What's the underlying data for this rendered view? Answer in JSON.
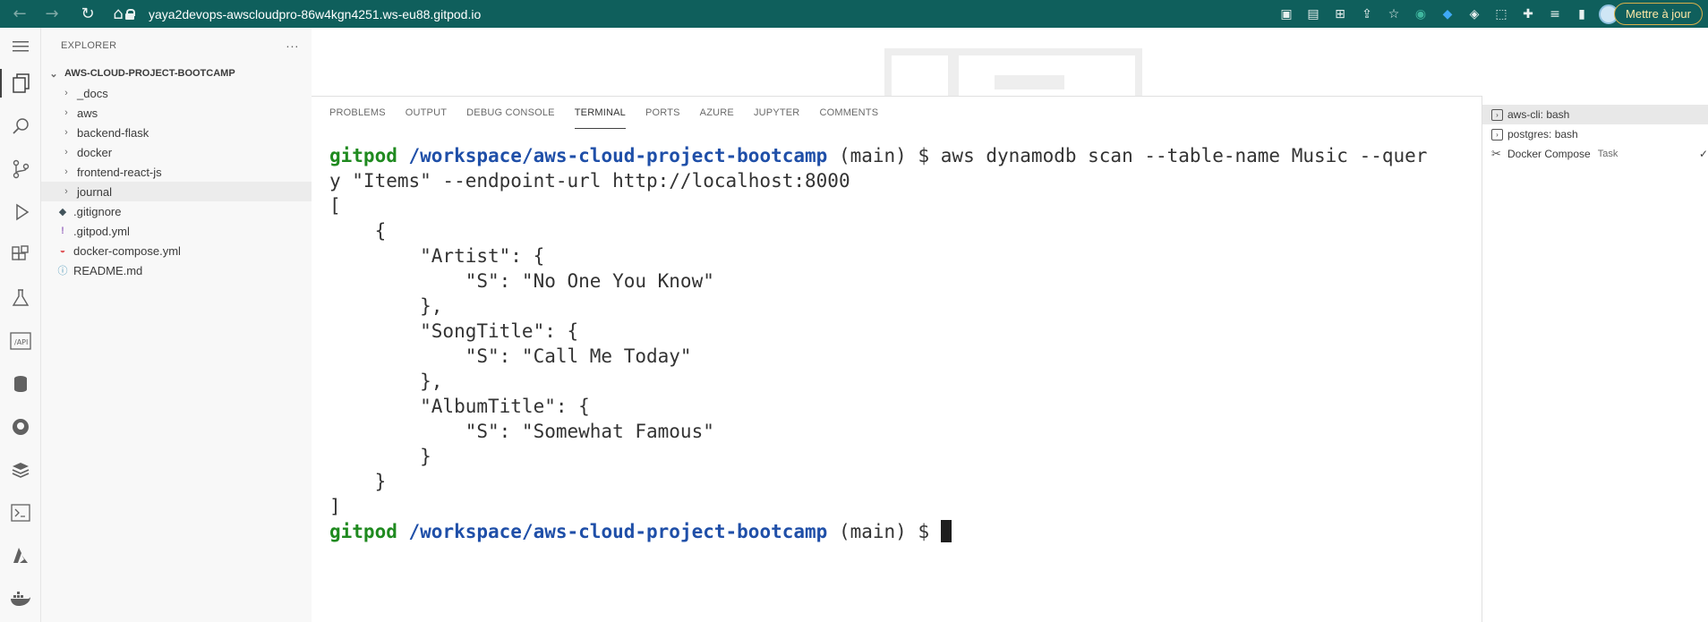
{
  "browser": {
    "url": "yaya2devops-awscloudpro-86w4kgn4251.ws-eu88.gitpod.io",
    "update_button": "Mettre à jour"
  },
  "sidebar": {
    "title": "EXPLORER",
    "more": "···",
    "root": "AWS-CLOUD-PROJECT-BOOTCAMP",
    "items": [
      {
        "label": "_docs",
        "kind": "folder"
      },
      {
        "label": "aws",
        "kind": "folder"
      },
      {
        "label": "backend-flask",
        "kind": "folder"
      },
      {
        "label": "docker",
        "kind": "folder"
      },
      {
        "label": "frontend-react-js",
        "kind": "folder"
      },
      {
        "label": "journal",
        "kind": "folder"
      },
      {
        "label": ".gitignore",
        "kind": "file"
      },
      {
        "label": ".gitpod.yml",
        "kind": "file"
      },
      {
        "label": "docker-compose.yml",
        "kind": "file"
      },
      {
        "label": "README.md",
        "kind": "file"
      }
    ]
  },
  "panel": {
    "tabs": [
      "PROBLEMS",
      "OUTPUT",
      "DEBUG CONSOLE",
      "TERMINAL",
      "PORTS",
      "AZURE",
      "JUPYTER",
      "COMMENTS"
    ],
    "active_tab": "TERMINAL"
  },
  "terminal": {
    "user": "gitpod",
    "path": "/workspace/aws-cloud-project-bootcamp",
    "branch": "(main) $",
    "command_line1": "aws dynamodb scan --table-name Music --quer",
    "command_line2": "y \"Items\" --endpoint-url http://localhost:8000",
    "output": [
      "[",
      "    {",
      "        \"Artist\": {",
      "            \"S\": \"No One You Know\"",
      "        },",
      "        \"SongTitle\": {",
      "            \"S\": \"Call Me Today\"",
      "        },",
      "        \"AlbumTitle\": {",
      "            \"S\": \"Somewhat Famous\"",
      "        }",
      "    }",
      "]"
    ]
  },
  "terminal_list": [
    {
      "label": "aws-cli: bash",
      "task": ""
    },
    {
      "label": "postgres: bash",
      "task": ""
    },
    {
      "label": "Docker Compose",
      "task": "Task"
    }
  ]
}
